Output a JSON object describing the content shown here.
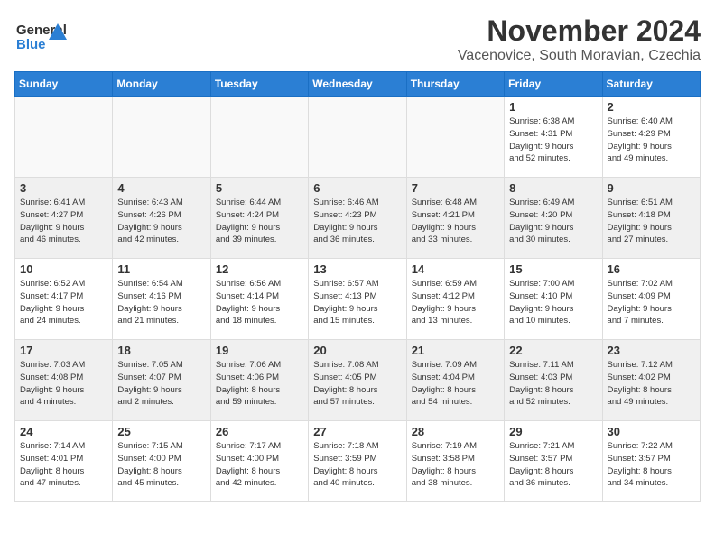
{
  "header": {
    "logo_general": "General",
    "logo_blue": "Blue",
    "month_year": "November 2024",
    "location": "Vacenovice, South Moravian, Czechia"
  },
  "weekdays": [
    "Sunday",
    "Monday",
    "Tuesday",
    "Wednesday",
    "Thursday",
    "Friday",
    "Saturday"
  ],
  "weeks": [
    [
      {
        "day": "",
        "info": ""
      },
      {
        "day": "",
        "info": ""
      },
      {
        "day": "",
        "info": ""
      },
      {
        "day": "",
        "info": ""
      },
      {
        "day": "",
        "info": ""
      },
      {
        "day": "1",
        "info": "Sunrise: 6:38 AM\nSunset: 4:31 PM\nDaylight: 9 hours\nand 52 minutes."
      },
      {
        "day": "2",
        "info": "Sunrise: 6:40 AM\nSunset: 4:29 PM\nDaylight: 9 hours\nand 49 minutes."
      }
    ],
    [
      {
        "day": "3",
        "info": "Sunrise: 6:41 AM\nSunset: 4:27 PM\nDaylight: 9 hours\nand 46 minutes."
      },
      {
        "day": "4",
        "info": "Sunrise: 6:43 AM\nSunset: 4:26 PM\nDaylight: 9 hours\nand 42 minutes."
      },
      {
        "day": "5",
        "info": "Sunrise: 6:44 AM\nSunset: 4:24 PM\nDaylight: 9 hours\nand 39 minutes."
      },
      {
        "day": "6",
        "info": "Sunrise: 6:46 AM\nSunset: 4:23 PM\nDaylight: 9 hours\nand 36 minutes."
      },
      {
        "day": "7",
        "info": "Sunrise: 6:48 AM\nSunset: 4:21 PM\nDaylight: 9 hours\nand 33 minutes."
      },
      {
        "day": "8",
        "info": "Sunrise: 6:49 AM\nSunset: 4:20 PM\nDaylight: 9 hours\nand 30 minutes."
      },
      {
        "day": "9",
        "info": "Sunrise: 6:51 AM\nSunset: 4:18 PM\nDaylight: 9 hours\nand 27 minutes."
      }
    ],
    [
      {
        "day": "10",
        "info": "Sunrise: 6:52 AM\nSunset: 4:17 PM\nDaylight: 9 hours\nand 24 minutes."
      },
      {
        "day": "11",
        "info": "Sunrise: 6:54 AM\nSunset: 4:16 PM\nDaylight: 9 hours\nand 21 minutes."
      },
      {
        "day": "12",
        "info": "Sunrise: 6:56 AM\nSunset: 4:14 PM\nDaylight: 9 hours\nand 18 minutes."
      },
      {
        "day": "13",
        "info": "Sunrise: 6:57 AM\nSunset: 4:13 PM\nDaylight: 9 hours\nand 15 minutes."
      },
      {
        "day": "14",
        "info": "Sunrise: 6:59 AM\nSunset: 4:12 PM\nDaylight: 9 hours\nand 13 minutes."
      },
      {
        "day": "15",
        "info": "Sunrise: 7:00 AM\nSunset: 4:10 PM\nDaylight: 9 hours\nand 10 minutes."
      },
      {
        "day": "16",
        "info": "Sunrise: 7:02 AM\nSunset: 4:09 PM\nDaylight: 9 hours\nand 7 minutes."
      }
    ],
    [
      {
        "day": "17",
        "info": "Sunrise: 7:03 AM\nSunset: 4:08 PM\nDaylight: 9 hours\nand 4 minutes."
      },
      {
        "day": "18",
        "info": "Sunrise: 7:05 AM\nSunset: 4:07 PM\nDaylight: 9 hours\nand 2 minutes."
      },
      {
        "day": "19",
        "info": "Sunrise: 7:06 AM\nSunset: 4:06 PM\nDaylight: 8 hours\nand 59 minutes."
      },
      {
        "day": "20",
        "info": "Sunrise: 7:08 AM\nSunset: 4:05 PM\nDaylight: 8 hours\nand 57 minutes."
      },
      {
        "day": "21",
        "info": "Sunrise: 7:09 AM\nSunset: 4:04 PM\nDaylight: 8 hours\nand 54 minutes."
      },
      {
        "day": "22",
        "info": "Sunrise: 7:11 AM\nSunset: 4:03 PM\nDaylight: 8 hours\nand 52 minutes."
      },
      {
        "day": "23",
        "info": "Sunrise: 7:12 AM\nSunset: 4:02 PM\nDaylight: 8 hours\nand 49 minutes."
      }
    ],
    [
      {
        "day": "24",
        "info": "Sunrise: 7:14 AM\nSunset: 4:01 PM\nDaylight: 8 hours\nand 47 minutes."
      },
      {
        "day": "25",
        "info": "Sunrise: 7:15 AM\nSunset: 4:00 PM\nDaylight: 8 hours\nand 45 minutes."
      },
      {
        "day": "26",
        "info": "Sunrise: 7:17 AM\nSunset: 4:00 PM\nDaylight: 8 hours\nand 42 minutes."
      },
      {
        "day": "27",
        "info": "Sunrise: 7:18 AM\nSunset: 3:59 PM\nDaylight: 8 hours\nand 40 minutes."
      },
      {
        "day": "28",
        "info": "Sunrise: 7:19 AM\nSunset: 3:58 PM\nDaylight: 8 hours\nand 38 minutes."
      },
      {
        "day": "29",
        "info": "Sunrise: 7:21 AM\nSunset: 3:57 PM\nDaylight: 8 hours\nand 36 minutes."
      },
      {
        "day": "30",
        "info": "Sunrise: 7:22 AM\nSunset: 3:57 PM\nDaylight: 8 hours\nand 34 minutes."
      }
    ]
  ]
}
